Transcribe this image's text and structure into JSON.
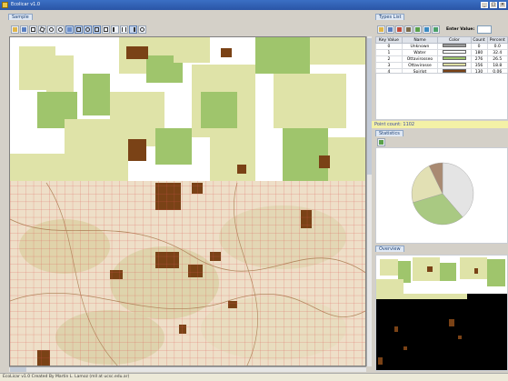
{
  "window": {
    "title": "Ecolicar v1.0"
  },
  "sample_panel": {
    "tab_label": "Sample"
  },
  "types_panel": {
    "tab_label": "Types List",
    "enter_value_label": "Enter Value:",
    "enter_value_value": "",
    "columns": [
      "Key Value",
      "Name",
      "Color",
      "Count",
      "Percent"
    ],
    "rows": [
      {
        "key": "0",
        "name": "Unknown",
        "color": "#9c9c9c",
        "count": "0",
        "percent": "0.0"
      },
      {
        "key": "1",
        "name": "Water",
        "color": "#ffffff",
        "count": "180",
        "percent": "32.4"
      },
      {
        "key": "2",
        "name": "Ottavirosseo",
        "color": "#9fc56c",
        "count": "276",
        "percent": "26.5"
      },
      {
        "key": "3",
        "name": "Ottavirosse",
        "color": "#dfe0a6",
        "count": "356",
        "percent": "18.8"
      },
      {
        "key": "4",
        "name": "Spirlot",
        "color": "#7a4216",
        "count": "130",
        "percent": "0.06"
      }
    ]
  },
  "point_count": "Point count: 1102",
  "statistics": {
    "tab_label": "Statistics",
    "pie": [
      {
        "label": "Water",
        "value": 32.4,
        "color": "#e4e4e4"
      },
      {
        "label": "Ottavirosseo",
        "value": 26.5,
        "color": "#a9c982"
      },
      {
        "label": "Ottavirosse",
        "value": 18.8,
        "color": "#e2e0b4"
      },
      {
        "label": "Spirlot",
        "value": 6.0,
        "color": "#a98a72"
      }
    ]
  },
  "overview": {
    "tab_label": "Overview"
  },
  "status": {
    "text": "EcoLicar v1.0 Created By Martin L. Lamoz (mll at ucsc.edu.ar)"
  },
  "colors": {
    "light": "#dfe3a8",
    "green": "#9fc56c",
    "brown": "#7a4216",
    "grid": "#d9534f"
  },
  "toolbar_icons": [
    "open-icon",
    "save-icon",
    "rect-select-icon",
    "polygon-icon",
    "zoom-in-icon",
    "zoom-out-icon",
    "pan-icon",
    "grid-icon",
    "circle-icon",
    "square-icon",
    "fit-icon",
    "align-left-icon",
    "align-center-icon",
    "align-right-icon",
    "refresh-icon"
  ],
  "types_toolbar_icons": [
    "open-icon",
    "save-icon",
    "edit-icon",
    "brush-icon",
    "filter-icon",
    "paint-icon",
    "export-icon"
  ]
}
